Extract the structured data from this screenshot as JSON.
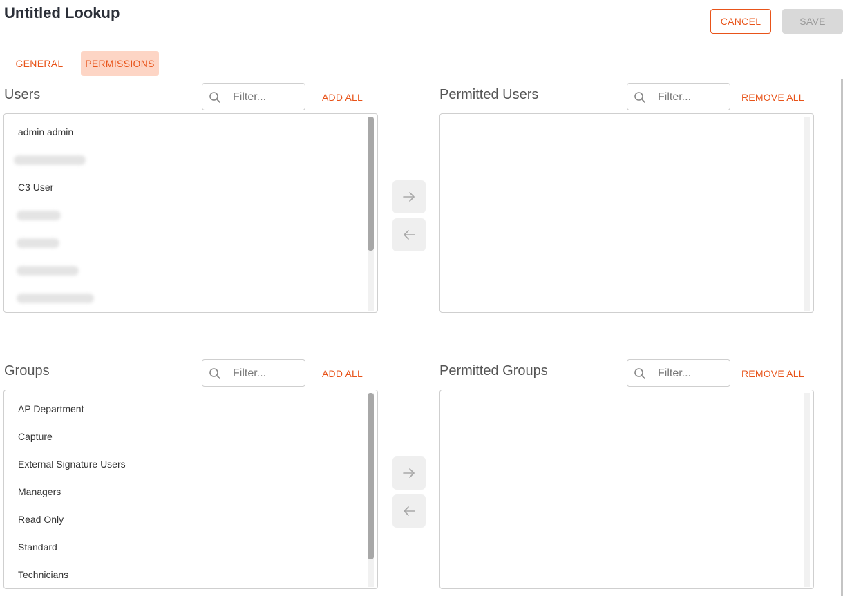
{
  "header": {
    "title": "Untitled Lookup",
    "cancel_label": "CANCEL",
    "save_label": "SAVE"
  },
  "tabs": [
    {
      "label": "GENERAL",
      "active": false
    },
    {
      "label": "PERMISSIONS",
      "active": true
    }
  ],
  "users": {
    "title": "Users",
    "filter_placeholder": "Filter...",
    "add_all_label": "ADD ALL",
    "items": [
      "admin admin",
      "C3 User"
    ]
  },
  "permitted_users": {
    "title": "Permitted Users",
    "filter_placeholder": "Filter...",
    "remove_all_label": "REMOVE ALL",
    "items": []
  },
  "groups": {
    "title": "Groups",
    "filter_placeholder": "Filter...",
    "add_all_label": "ADD ALL",
    "items": [
      "AP Department",
      "Capture",
      "External Signature Users",
      "Managers",
      "Read Only",
      "Standard",
      "Technicians"
    ]
  },
  "permitted_groups": {
    "title": "Permitted Groups",
    "filter_placeholder": "Filter...",
    "remove_all_label": "REMOVE ALL",
    "items": []
  },
  "icons": {
    "search": "search-icon",
    "add": "arrow-right-icon",
    "remove": "arrow-left-icon"
  },
  "colors": {
    "accent": "#e8541a",
    "active_tab_bg": "#fdd5c5",
    "disabled_button_bg": "#d9d9d9"
  }
}
